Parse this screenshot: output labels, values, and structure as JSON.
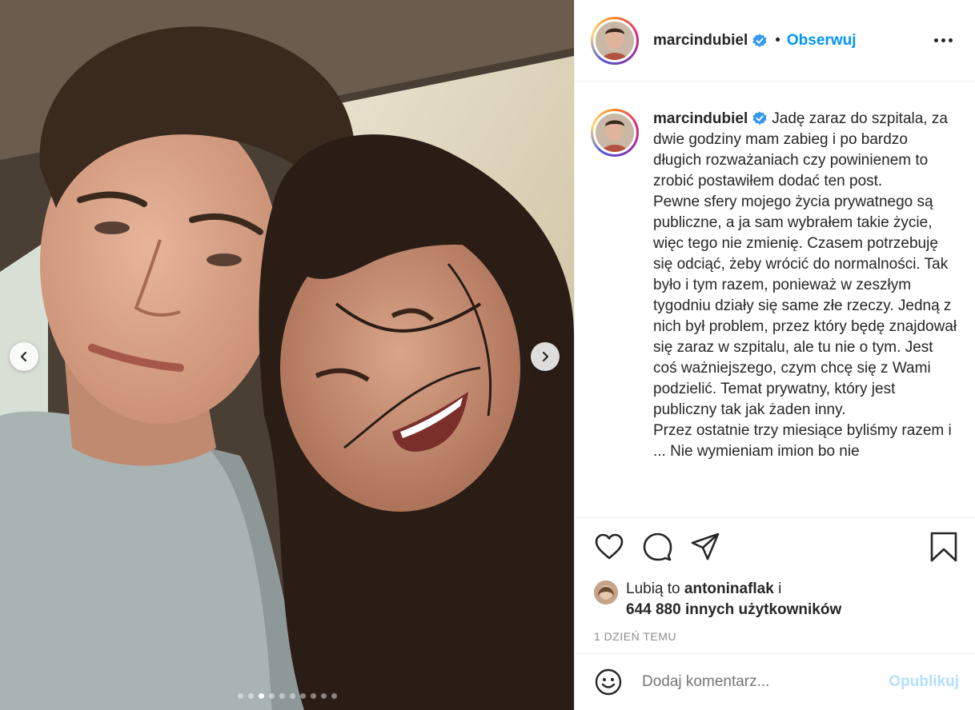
{
  "post": {
    "username": "marcindubiel",
    "separator": "•",
    "follow_label": "Obserwuj",
    "caption": "Jadę zaraz do szpitala, za dwie godziny mam zabieg i po bardzo długich rozważaniach czy powinienem to zrobić postawiłem dodać ten post.\nPewne sfery mojego życia prywatnego są publiczne, a ja sam wybrałem takie życie, więc tego nie zmienię. Czasem potrzebuję się odciąć, żeby wrócić do normalności. Tak było i tym razem, ponieważ w zeszłym tygodniu działy się same złe rzeczy. Jedną z nich był problem, przez który będę znajdował się zaraz w szpitalu, ale tu nie o tym. Jest coś ważniejszego, czym chcę się z Wami podzielić. Temat prywatny, który jest publiczny tak jak żaden inny.\nPrzez ostatnie trzy miesiące byliśmy razem i ... Nie wymieniam imion bo nie",
    "likes_prefix": "Lubią to",
    "likes_user": "antoninaflak",
    "likes_conj": "i",
    "likes_count": "644 880 innych użytkowników",
    "timestamp": "1 DZIEŃ TEMU",
    "comment_placeholder": "Dodaj komentarz...",
    "publish_label": "Opublikuj"
  },
  "carousel": {
    "total": 10,
    "active": 2
  },
  "icons": [
    "verified-badge-icon",
    "more-options-icon",
    "heart-icon",
    "comment-icon",
    "share-icon",
    "bookmark-icon",
    "emoji-icon",
    "chevron-left-icon",
    "chevron-right-icon"
  ],
  "colors": {
    "accent": "#0095f6",
    "publish_disabled": "#b2dffc",
    "meta_text": "#8e8e8e",
    "verified": "#3897f0"
  }
}
